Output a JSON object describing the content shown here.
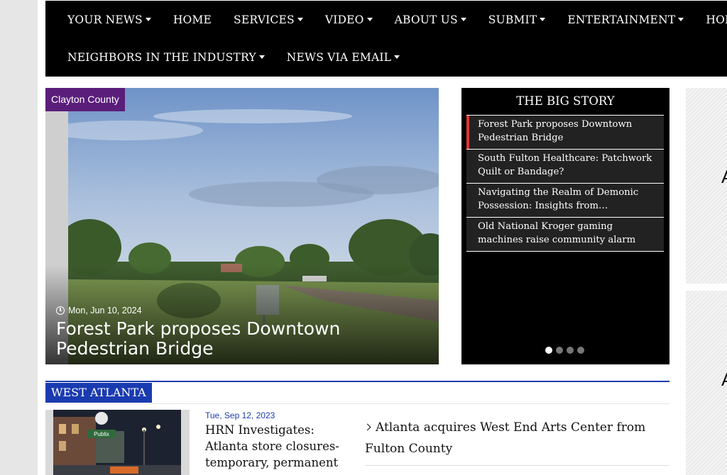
{
  "nav": {
    "row1": [
      {
        "label": "YOUR NEWS",
        "caret": true
      },
      {
        "label": "HOME",
        "caret": false
      },
      {
        "label": "SERVICES",
        "caret": true
      },
      {
        "label": "VIDEO",
        "caret": true
      },
      {
        "label": "ABOUT US",
        "caret": true
      },
      {
        "label": "SUBMIT",
        "caret": true
      },
      {
        "label": "ENTERTAINMENT",
        "caret": true
      },
      {
        "label": "HOMEFRONT",
        "caret": true
      }
    ],
    "row2": [
      {
        "label": "NEIGHBORS IN THE INDUSTRY",
        "caret": true
      },
      {
        "label": "NEWS VIA EMAIL",
        "caret": true
      }
    ]
  },
  "hero": {
    "category": "Clayton County",
    "date": "Mon, Jun 10, 2024",
    "title": "Forest Park proposes Downtown Pedestrian Bridge"
  },
  "big_story": {
    "heading": "THE BIG STORY",
    "items": [
      "Forest Park proposes Downtown Pedestrian Bridge",
      "South Fulton Healthcare: Patchwork Quilt or Bandage?",
      "Navigating the Realm of Demonic Possession: Insights from Archbishop...",
      "Old National Kroger gaming machines raise community alarm"
    ],
    "active_index": 0,
    "slides": 4,
    "current_slide": 0
  },
  "west_atlanta": {
    "section_label": "WEST ATLANTA",
    "featured": {
      "date": "Tue, Sep 12, 2023",
      "title": "HRN Investigates: Atlanta store closures-temporary, permanent",
      "image_sign": "Publix"
    },
    "links": [
      "Atlanta acquires West End Arts Center from Fulton County"
    ]
  },
  "side_ads": {
    "glyph": "A"
  },
  "colors": {
    "nav_bg": "#000000",
    "category_bg": "#5a1e7a",
    "section_blue": "#1a3bb0",
    "active_marker": "#e03333"
  }
}
